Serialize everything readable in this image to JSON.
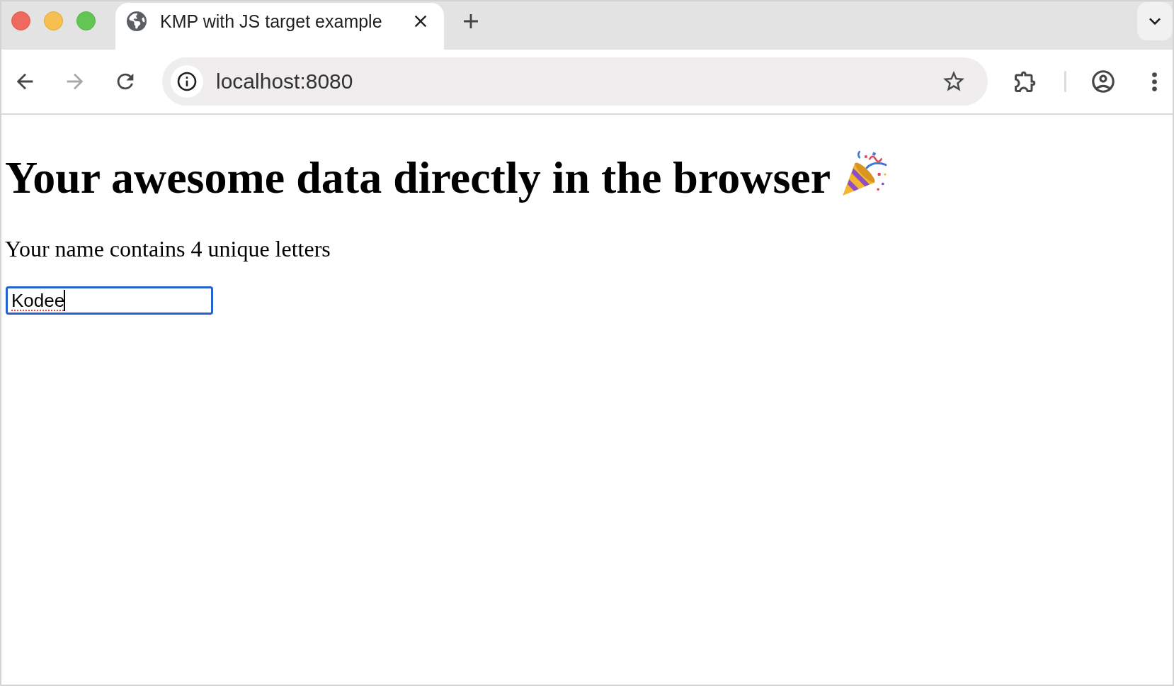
{
  "window": {
    "tabs": [
      {
        "title": "KMP with JS target example",
        "selected": true
      }
    ]
  },
  "toolbar": {
    "nav_buttons": [
      {
        "kind": "back",
        "disabled": false
      },
      {
        "kind": "forward",
        "disabled": true
      },
      {
        "kind": "reload",
        "disabled": false
      }
    ],
    "address_bar": {
      "url": "localhost:8080"
    }
  },
  "page": {
    "heading": "Your awesome data directly in the browser",
    "message": "Your name contains 4 unique letters",
    "name_field": {
      "value": "Kodee",
      "focused": true,
      "spelling_flagged": true
    }
  }
}
